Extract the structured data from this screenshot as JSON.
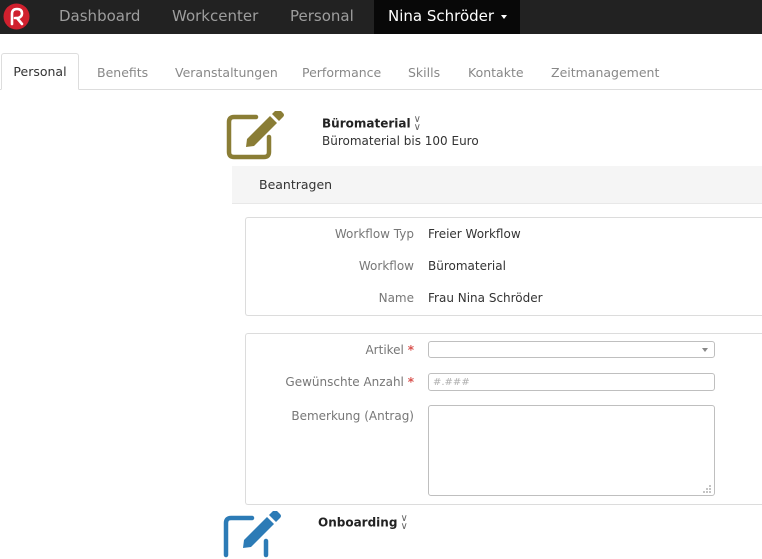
{
  "colors": {
    "brand": "#d0202e",
    "navbar": "#222222",
    "icon_olive": "#8a7d35",
    "icon_blue": "#2c7bb6",
    "required": "#d9534f"
  },
  "topnav": {
    "logo_icon": "brand-logo-icon",
    "items": [
      "Dashboard",
      "Workcenter",
      "Personal"
    ],
    "user": "Nina Schröder"
  },
  "tabs": {
    "active": "Personal",
    "items": [
      "Benefits",
      "Veranstaltungen",
      "Performance",
      "Skills",
      "Kontakte",
      "Zeitmanagement"
    ]
  },
  "workflow": {
    "icon": "edit-icon",
    "title": "Büromaterial",
    "subtitle": "Büromaterial bis 100 Euro",
    "section": "Beantragen",
    "info": {
      "type_label": "Workflow Typ",
      "type_value": "Freier Workflow",
      "workflow_label": "Workflow",
      "workflow_value": "Büromaterial",
      "name_label": "Name",
      "name_value": "Frau Nina Schröder"
    },
    "form": {
      "artikel_label": "Artikel",
      "artikel_value": "",
      "anzahl_label": "Gewünschte Anzahl",
      "anzahl_placeholder": "#.###",
      "bemerkung_label": "Bemerkung (Antrag)",
      "required_marker": "*"
    }
  },
  "next_workflow": {
    "icon": "edit-icon",
    "title": "Onboarding"
  }
}
